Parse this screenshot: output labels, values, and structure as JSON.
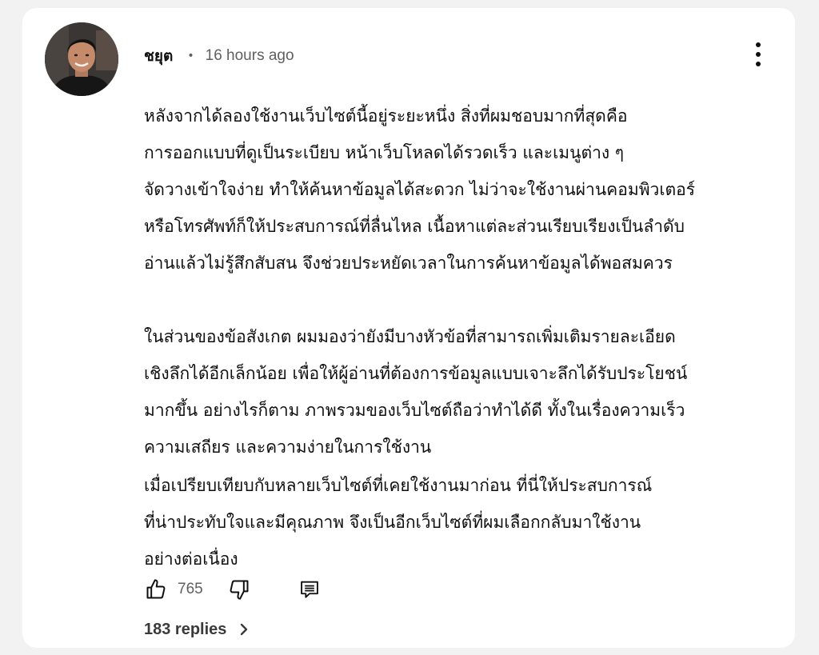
{
  "comment": {
    "author": "ชยุต",
    "separator": "•",
    "timestamp": "16 hours ago",
    "body": {
      "paragraph1": [
        "หลังจากได้ลองใช้งานเว็บไซต์นี้อยู่ระยะหนึ่ง สิ่งที่ผมชอบมากที่สุดคือ",
        "การออกแบบที่ดูเป็นระเบียบ หน้าเว็บโหลดได้รวดเร็ว และเมนูต่าง ๆ",
        "จัดวางเข้าใจง่าย ทำให้ค้นหาข้อมูลได้สะดวก ไม่ว่าจะใช้งานผ่านคอมพิวเตอร์",
        "หรือโทรศัพท์ก็ให้ประสบการณ์ที่ลื่นไหล เนื้อหาแต่ละส่วนเรียบเรียงเป็นลำดับ",
        "อ่านแล้วไม่รู้สึกสับสน จึงช่วยประหยัดเวลาในการค้นหาข้อมูลได้พอสมควร"
      ],
      "paragraph2": [
        "ในส่วนของข้อสังเกต ผมมองว่ายังมีบางหัวข้อที่สามารถเพิ่มเติมรายละเอียด",
        "เชิงลึกได้อีกเล็กน้อย เพื่อให้ผู้อ่านที่ต้องการข้อมูลแบบเจาะลึกได้รับประโยชน์",
        "มากขึ้น อย่างไรก็ตาม ภาพรวมของเว็บไซต์ถือว่าทำได้ดี ทั้งในเรื่องความเร็ว",
        "ความเสถียร และความง่ายในการใช้งาน"
      ],
      "paragraph3": [
        "เมื่อเปรียบเทียบกับหลายเว็บไซต์ที่เคยใช้งานมาก่อน ที่นี่ให้ประสบการณ์",
        "ที่น่าประทับใจและมีคุณภาพ จึงเป็นอีกเว็บไซต์ที่ผมเลือกกลับมาใช้งาน",
        "อย่างต่อเนื่อง"
      ]
    },
    "actions": {
      "like_icon": "thumbs-up-icon",
      "like_count": "765",
      "dislike_icon": "thumbs-down-icon",
      "reply_icon": "reply-icon"
    },
    "replies": {
      "label": "183 replies",
      "icon": "chevron-right-icon"
    },
    "menu_icon": "more-vertical-icon"
  },
  "colors": {
    "background": "#f2f2f2",
    "card": "#ffffff",
    "text_primary": "#0f0f0f",
    "text_secondary": "#606060"
  }
}
